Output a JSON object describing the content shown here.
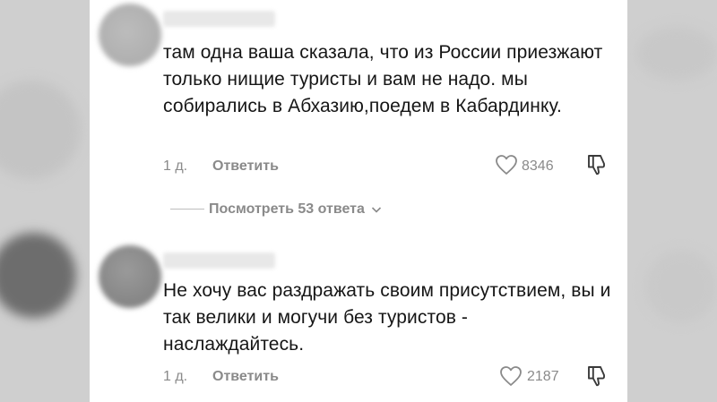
{
  "comments": [
    {
      "text": "там одна ваша сказала, что из России приезжают только нищие туристы и вам не надо. мы собирались в Абхазию,поедем в Кабардинку.",
      "time": "1 д.",
      "reply_label": "Ответить",
      "likes": "8346"
    },
    {
      "text": "Не хочу вас раздражать своим присутствием, вы и так велики и могучи без туристов - наслаждайтесь.",
      "time": "1 д.",
      "reply_label": "Ответить",
      "likes": "2187"
    }
  ],
  "view_replies": "Посмотреть 53 ответа",
  "colors": {
    "text": "#161616",
    "meta": "#8a8a8a",
    "card": "#ffffff"
  },
  "icons": [
    "heart-icon",
    "dislike-icon",
    "chevron-down-icon"
  ]
}
